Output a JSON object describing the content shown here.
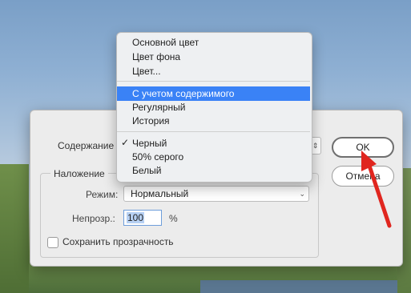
{
  "dialog": {
    "content_label": "Содержание",
    "content_dropdown_chevron": "chevron-updown-icon",
    "overlay_group_title": "Наложение",
    "mode_label": "Режим:",
    "mode_value": "Нормальный",
    "opacity_label": "Непрозр.:",
    "opacity_value": "100",
    "opacity_unit": "%",
    "preserve_transparency_label": "Сохранить прозрачность",
    "preserve_transparency_checked": false,
    "ok_label": "OK",
    "cancel_label": "Отмена"
  },
  "dropdown_menu": {
    "group1": [
      "Основной цвет",
      "Цвет фона",
      "Цвет..."
    ],
    "group2": [
      "С учетом содержимого",
      "Регулярный",
      "История"
    ],
    "group3": [
      "Черный",
      "50% серого",
      "Белый"
    ],
    "highlighted_item": "С учетом содержимого",
    "checked_item": "Черный",
    "checkmark_glyph": "✓"
  },
  "annotation": {
    "arrow_color": "#e0261f"
  },
  "colors": {
    "menu_highlight": "#3a82f6",
    "dialog_bg": "#ececec"
  }
}
